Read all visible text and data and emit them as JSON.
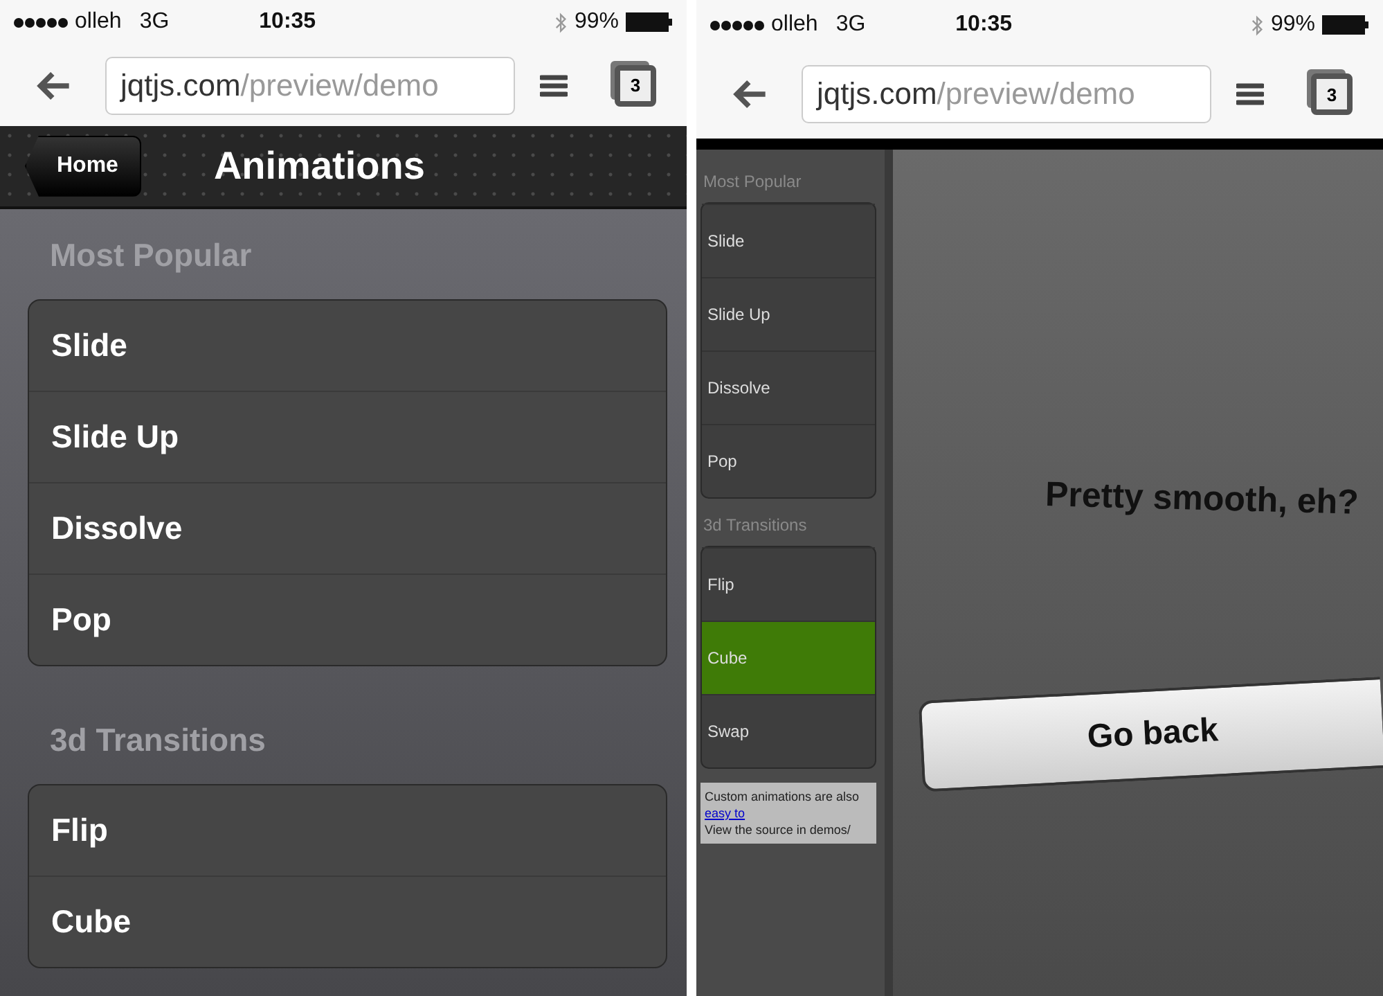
{
  "screens": [
    {
      "status_bar": {
        "carrier": "olleh",
        "network": "3G",
        "time": "10:35",
        "battery": "99%"
      },
      "browser": {
        "url_host": "jqtjs.com",
        "url_path": "/preview/demo",
        "tab_count": "3"
      },
      "toolbar": {
        "back": "Home",
        "title": "Animations"
      },
      "sections": [
        {
          "title": "Most Popular",
          "items": [
            {
              "label": "Slide"
            },
            {
              "label": "Slide Up"
            },
            {
              "label": "Dissolve"
            },
            {
              "label": "Pop"
            }
          ]
        },
        {
          "title": "3d Transitions",
          "items": [
            {
              "label": "Flip"
            },
            {
              "label": "Cube"
            }
          ]
        }
      ]
    },
    {
      "status_bar": {
        "carrier": "olleh",
        "network": "3G",
        "time": "10:35",
        "battery": "99%"
      },
      "browser": {
        "url_host": "jqtjs.com",
        "url_path": "/preview/demo",
        "tab_count": "3"
      },
      "cube_face": {
        "sections": [
          {
            "title": "Most Popular",
            "items": [
              {
                "label": "Slide",
                "selected": false
              },
              {
                "label": "Slide Up",
                "selected": false
              },
              {
                "label": "Dissolve",
                "selected": false
              },
              {
                "label": "Pop",
                "selected": false
              }
            ]
          },
          {
            "title": "3d Transitions",
            "items": [
              {
                "label": "Flip",
                "selected": false
              },
              {
                "label": "Cube",
                "selected": true
              },
              {
                "label": "Swap",
                "selected": false
              }
            ]
          }
        ],
        "footer": {
          "text": "Custom animations are also ",
          "link": "easy to",
          "line2": "View the source in demos/"
        }
      },
      "message": "Pretty smooth, eh?",
      "button": "Go back"
    }
  ]
}
